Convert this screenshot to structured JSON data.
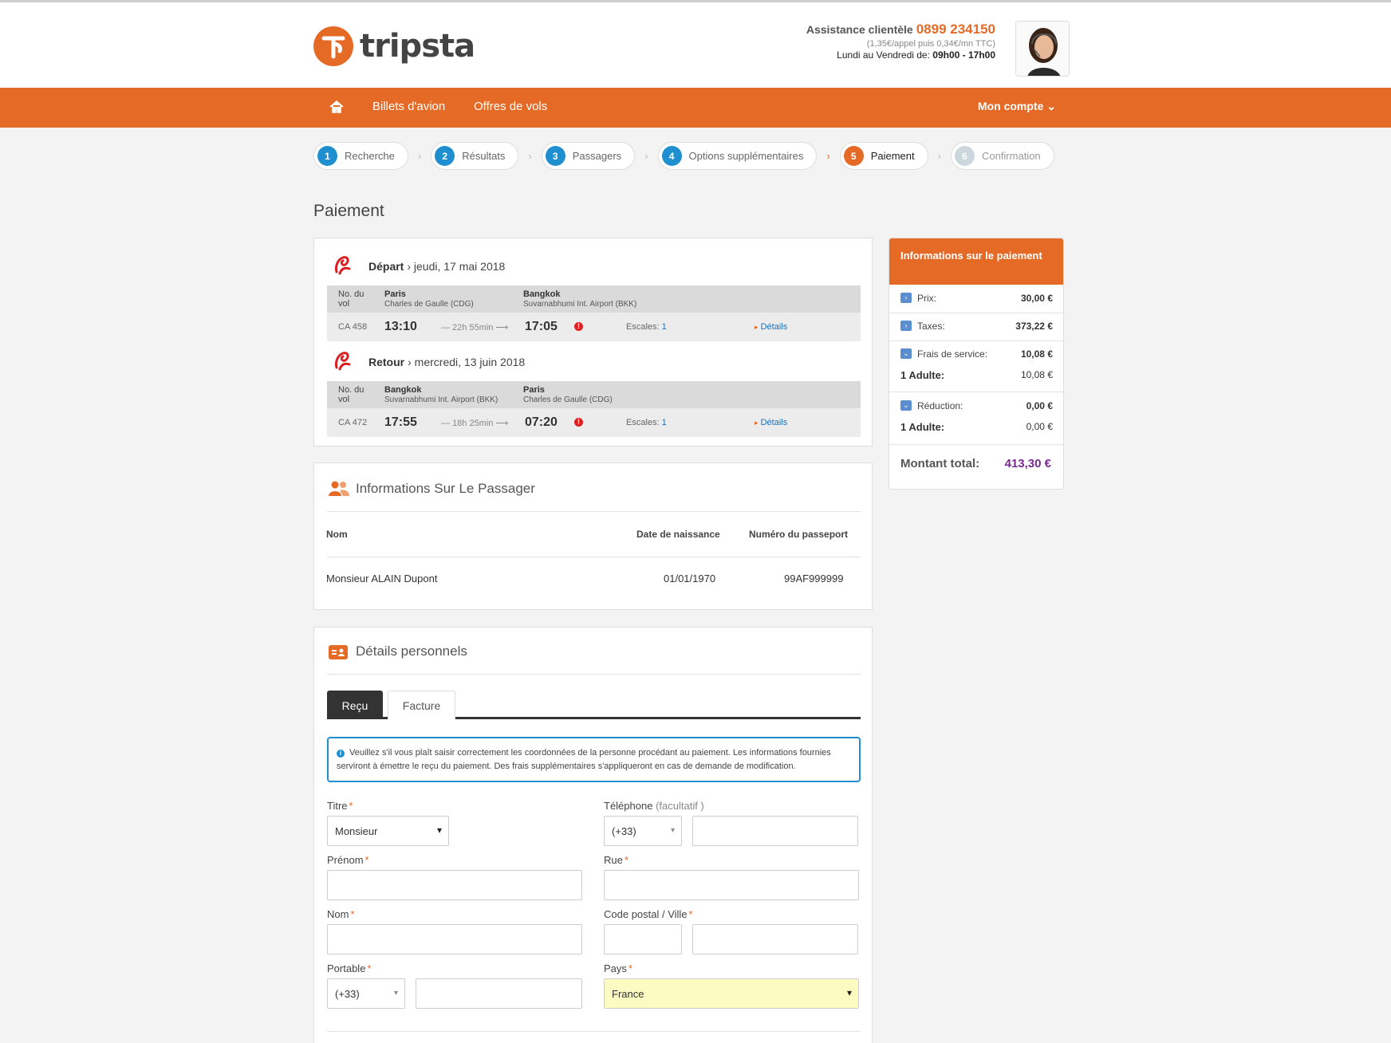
{
  "brand": {
    "name": "tripsta"
  },
  "assistance": {
    "label": "Assistance clientèle",
    "phone": "0899 234150",
    "rate": "(1,35€/appel puis 0,34€/mn TTC)",
    "hours_label": "Lundi au Vendredi de:",
    "hours": "09h00 - 17h00"
  },
  "nav": {
    "items": [
      "Billets d'avion",
      "Offres de vols"
    ],
    "account": "Mon compte"
  },
  "steps": [
    {
      "num": "1",
      "label": "Recherche"
    },
    {
      "num": "2",
      "label": "Résultats"
    },
    {
      "num": "3",
      "label": "Passagers"
    },
    {
      "num": "4",
      "label": "Options supplémentaires"
    },
    {
      "num": "5",
      "label": "Paiement"
    },
    {
      "num": "6",
      "label": "Confirmation"
    }
  ],
  "page_title": "Paiement",
  "flights": [
    {
      "direction": "Départ",
      "date": "› jeudi, 17 mai 2018",
      "flight_label": "No. du vol",
      "from_city": "Paris",
      "from_airport": "Charles de Gaulle (CDG)",
      "to_city": "Bangkok",
      "to_airport": "Suvarnabhumi Int. Airport (BKK)",
      "flight_no": "CA 458",
      "dep_time": "13:10",
      "duration": "— 22h 55min ⟶",
      "arr_time": "17:05",
      "stops_label": "Escales:",
      "stops": "1",
      "details": "Détails"
    },
    {
      "direction": "Retour",
      "date": "› mercredi, 13 juin 2018",
      "flight_label": "No. du vol",
      "from_city": "Bangkok",
      "from_airport": "Suvarnabhumi Int. Airport (BKK)",
      "to_city": "Paris",
      "to_airport": "Charles de Gaulle (CDG)",
      "flight_no": "CA 472",
      "dep_time": "17:55",
      "duration": "— 18h 25min ⟶",
      "arr_time": "07:20",
      "stops_label": "Escales:",
      "stops": "1",
      "details": "Détails"
    }
  ],
  "passenger": {
    "title": "Informations Sur Le Passager",
    "col_name": "Nom",
    "col_dob": "Date de naissance",
    "col_passport": "Numéro du passeport",
    "name": "Monsieur ALAIN Dupont",
    "dob": "01/01/1970",
    "passport": "99AF999999"
  },
  "personal": {
    "title": "Détails personnels",
    "tabs": [
      "Reçu",
      "Facture"
    ],
    "info": "Veuillez s'il vous plaît saisir correctement les coordonnées de la personne procédant au paiement. Les informations fournies serviront à émettre le reçu du paiement. Des frais supplémentaires s'appliqueront en cas de demande de modification.",
    "labels": {
      "titre": "Titre",
      "telephone": "Téléphone",
      "telephone_opt": "(facultatif )",
      "prenom": "Prénom",
      "rue": "Rue",
      "nom": "Nom",
      "cp_ville": "Code postal / Ville",
      "portable": "Portable",
      "pays": "Pays"
    },
    "values": {
      "titre": "Monsieur",
      "tel_prefix": "(+33)",
      "portable_prefix": "(+33)",
      "pays": "France"
    }
  },
  "summary": {
    "title": "Informations sur le paiement",
    "prix_label": "Prix:",
    "prix": "30,00 €",
    "taxes_label": "Taxes:",
    "taxes": "373,22 €",
    "frais_label": "Frais de service:",
    "frais": "10,08 €",
    "frais_adult_label": "1 Adulte:",
    "frais_adult": "10,08 €",
    "reduction_label": "Réduction:",
    "reduction": "0,00 €",
    "reduction_adult_label": "1 Adulte:",
    "reduction_adult": "0,00 €",
    "total_label": "Montant total:",
    "total": "413,30 €"
  },
  "colors": {
    "brand_orange": "#e46a26",
    "step_blue": "#1f8fd0",
    "total_purple": "#7a2a8f"
  }
}
